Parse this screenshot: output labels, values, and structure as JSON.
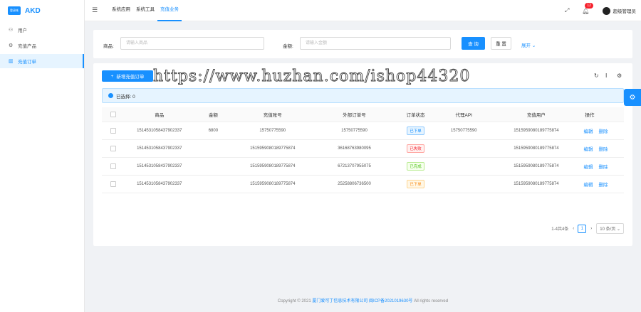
{
  "brand": {
    "logo_text": "AKD",
    "logo_mark": "登录帐"
  },
  "sidebar": {
    "items": [
      {
        "label": "用户",
        "icon": "user-icon",
        "active": false
      },
      {
        "label": "充值产品",
        "icon": "product-icon",
        "active": false
      },
      {
        "label": "充值订单",
        "icon": "order-icon",
        "active": true
      }
    ]
  },
  "header": {
    "tabs": [
      {
        "label": "系统应用",
        "active": false
      },
      {
        "label": "系统工具",
        "active": false
      },
      {
        "label": "充值业务",
        "active": true
      }
    ],
    "notification_count": "12",
    "user_name": "超级管理员"
  },
  "search": {
    "product_label": "商品:",
    "product_placeholder": "请输入商品",
    "amount_label": "金额:",
    "amount_placeholder": "请输入金额",
    "query_button": "查 询",
    "reset_button": "重 置",
    "expand_link": "展开"
  },
  "table_toolbar": {
    "add_button": "新增充值订单",
    "selected_text": "已选择: 0"
  },
  "table": {
    "columns": [
      "",
      "商品",
      "金额",
      "充值账号",
      "外部订单号",
      "订单状态",
      "代理API",
      "充值用户",
      "操作"
    ],
    "rows": [
      {
        "product": "1514531058437902337",
        "amount": "6800",
        "account": "15750775590",
        "ext_order": "15750775590",
        "status": "已下单",
        "status_color": "#1890ff",
        "api": "15750775590",
        "user": "1515959080189775874",
        "edit": "编辑",
        "delete": "删除"
      },
      {
        "product": "1514531058437902337",
        "amount": "",
        "account": "1515959080189775874",
        "ext_order": "36168763980095",
        "status": "已失败",
        "status_color": "#f5222d",
        "api": "",
        "user": "1515959080189775874",
        "edit": "编辑",
        "delete": "删除"
      },
      {
        "product": "1514531058437902337",
        "amount": "",
        "account": "1515959080189775874",
        "ext_order": "67213707955075",
        "status": "已完成",
        "status_color": "#52c41a",
        "api": "",
        "user": "1515959080189775874",
        "edit": "编辑",
        "delete": "删除"
      },
      {
        "product": "1514531058437902337",
        "amount": "",
        "account": "1515959080189775874",
        "ext_order": "25258806736500",
        "status": "已下单",
        "status_color": "#fa8c16",
        "api": "",
        "user": "1515959080189775874",
        "edit": "编辑",
        "delete": "删除"
      }
    ]
  },
  "pagination": {
    "summary": "1-4共4条",
    "current_page": "1",
    "page_size": "10 条/页"
  },
  "footer": {
    "copyright": "Copyright © 2021",
    "company": "厦门爱可丁信息技术有限公司",
    "icp": "闽ICP备2021019630号",
    "rights": "All rights reserved"
  },
  "watermark": "https://www.huzhan.com/ishop44320",
  "colors": {
    "primary": "#1890ff"
  }
}
